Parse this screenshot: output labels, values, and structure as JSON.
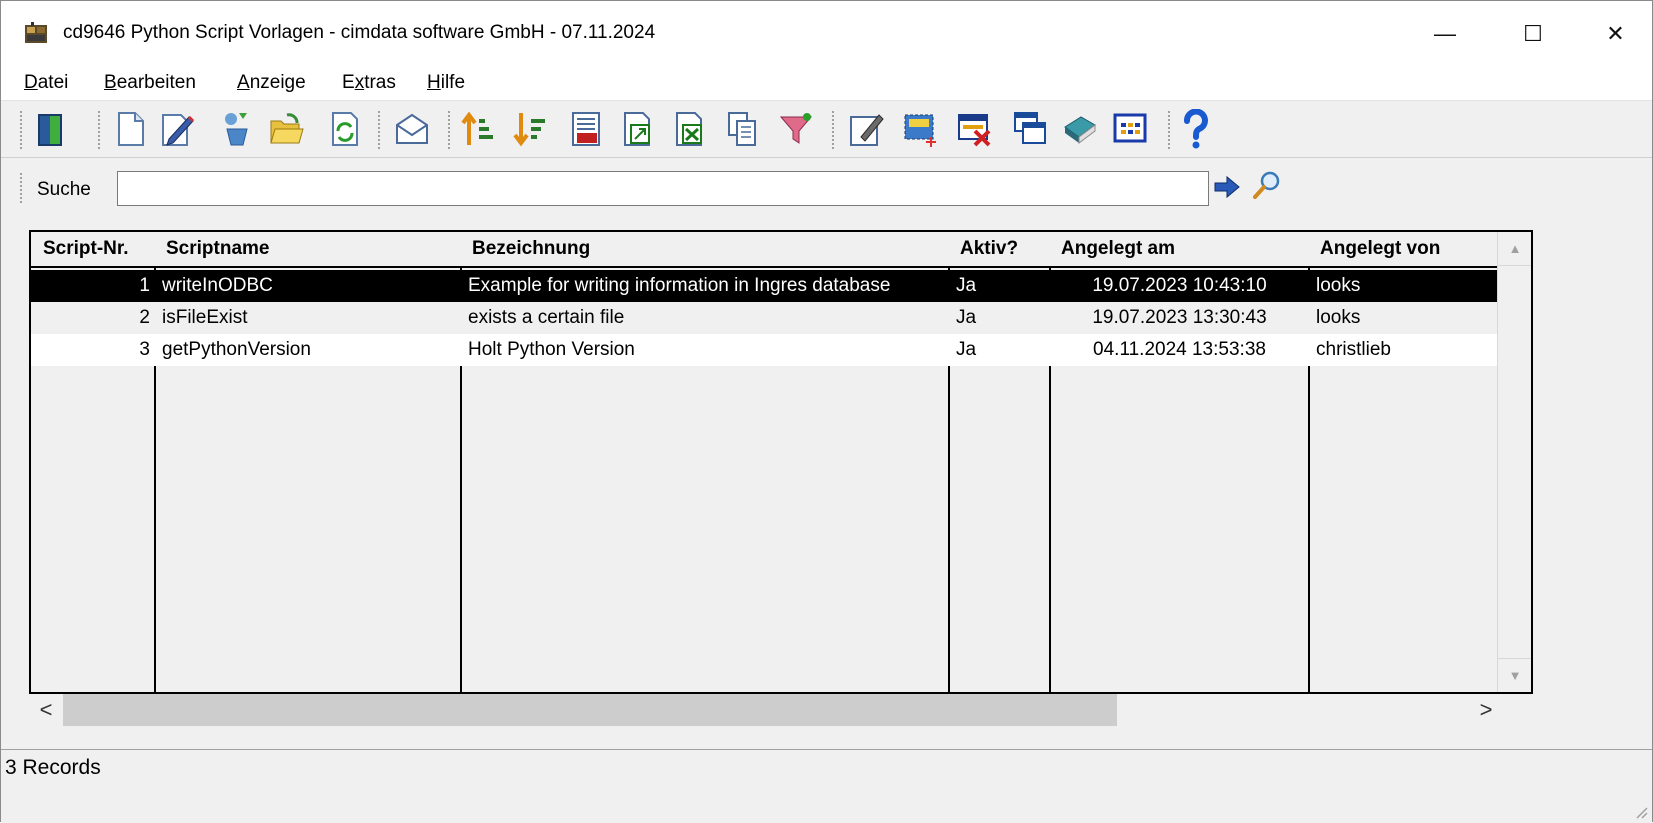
{
  "window": {
    "title": "cd9646 Python Script Vorlagen - cimdata software GmbH - 07.11.2024",
    "minimize": "—",
    "maximize": "☐",
    "close": "✕"
  },
  "menu": [
    {
      "first": "D",
      "rest": "atei"
    },
    {
      "first": "B",
      "rest": "earbeiten"
    },
    {
      "first": "A",
      "rest": "nzeige"
    },
    {
      "prefix": "E",
      "first": "x",
      "rest": "tras"
    },
    {
      "first": "H",
      "rest": "ilfe"
    }
  ],
  "toolbar": {
    "icons": [
      "exit-door-icon",
      "new-document-icon",
      "edit-pencil-icon",
      "copy-record-icon",
      "open-folder-icon",
      "refresh-icon",
      "mail-icon",
      "sort-ascending-icon",
      "sort-descending-icon",
      "number-format-icon",
      "export-icon",
      "excel-export-icon",
      "copy-pages-icon",
      "filter-icon",
      "edit-form-icon",
      "select-area-icon",
      "delete-record-icon",
      "windows-icon",
      "book-icon",
      "grid-view-icon",
      "help-icon"
    ]
  },
  "search": {
    "label": "Suche",
    "value": ""
  },
  "table": {
    "columns": [
      "Script-Nr.",
      "Scriptname",
      "Bezeichnung",
      "Aktiv?",
      "Angelegt am",
      "Angelegt von"
    ],
    "rows": [
      {
        "nr": "1",
        "name": "writeInODBC",
        "desc": "Example for writing information in Ingres database",
        "active": "Ja",
        "created": "19.07.2023 10:43:10",
        "by": "looks",
        "selected": true
      },
      {
        "nr": "2",
        "name": "isFileExist",
        "desc": "exists a certain file",
        "active": "Ja",
        "created": "19.07.2023 13:30:43",
        "by": "looks",
        "selected": false
      },
      {
        "nr": "3",
        "name": "getPythonVersion",
        "desc": "Holt Python Version",
        "active": "Ja",
        "created": "04.11.2024 13:53:38",
        "by": "christlieb",
        "selected": false
      }
    ]
  },
  "scroll": {
    "left": "<",
    "right": ">",
    "up": "▲",
    "down": "▼"
  },
  "status": {
    "records": "3 Records"
  },
  "colors": {
    "selected_row": "#000000",
    "alt_row": "#f0f0f0",
    "window_bg": "#f0f0f0"
  }
}
